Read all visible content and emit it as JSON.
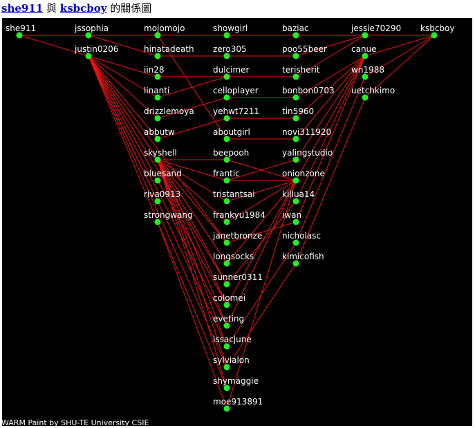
{
  "header": {
    "user_a": "she911",
    "connector": "與",
    "user_b": "ksbcboy",
    "suffix": "的關係圖"
  },
  "footer": {
    "credit": "WARM Paint by SHU-TE University CSIE"
  },
  "colors": {
    "background": "#000000",
    "node": "#22ee22",
    "edge": "#ee1111",
    "label": "#ffffff"
  },
  "graph": {
    "nodes": [
      {
        "id": "she911",
        "label": "she911",
        "col": 0,
        "row": 0
      },
      {
        "id": "jssophia",
        "label": "jssophia",
        "col": 1,
        "row": 0
      },
      {
        "id": "justin0206",
        "label": "justin0206",
        "col": 1,
        "row": 1
      },
      {
        "id": "mojomojo",
        "label": "mojomojo",
        "col": 2,
        "row": 0
      },
      {
        "id": "hinatadeath",
        "label": "hinatadeath",
        "col": 2,
        "row": 1
      },
      {
        "id": "iin28",
        "label": "iin28",
        "col": 2,
        "row": 2
      },
      {
        "id": "linanti",
        "label": "linanti",
        "col": 2,
        "row": 3
      },
      {
        "id": "drizzlemoya",
        "label": "drizzlemoya",
        "col": 2,
        "row": 4
      },
      {
        "id": "abbutw",
        "label": "abbutw",
        "col": 2,
        "row": 5
      },
      {
        "id": "skyshell",
        "label": "skyshell",
        "col": 2,
        "row": 6
      },
      {
        "id": "bluesand",
        "label": "bluesand",
        "col": 2,
        "row": 7
      },
      {
        "id": "riva0913",
        "label": "riva0913",
        "col": 2,
        "row": 8
      },
      {
        "id": "strongwang",
        "label": "strongwang",
        "col": 2,
        "row": 9
      },
      {
        "id": "showgirl",
        "label": "showgirl",
        "col": 3,
        "row": 0
      },
      {
        "id": "zero305",
        "label": "zero305",
        "col": 3,
        "row": 1
      },
      {
        "id": "dulcimer",
        "label": "dulcimer",
        "col": 3,
        "row": 2
      },
      {
        "id": "celloplayer",
        "label": "celloplayer",
        "col": 3,
        "row": 3
      },
      {
        "id": "yehwt7211",
        "label": "yehwt7211",
        "col": 3,
        "row": 4
      },
      {
        "id": "aboutgirl",
        "label": "aboutgirl",
        "col": 3,
        "row": 5
      },
      {
        "id": "beepooh",
        "label": "beepooh",
        "col": 3,
        "row": 6
      },
      {
        "id": "frantic",
        "label": "frantic",
        "col": 3,
        "row": 7
      },
      {
        "id": "tristantsai",
        "label": "tristantsai",
        "col": 3,
        "row": 8
      },
      {
        "id": "frankyu1984",
        "label": "frankyu1984",
        "col": 3,
        "row": 9
      },
      {
        "id": "janetbronze",
        "label": "janetbronze",
        "col": 3,
        "row": 10
      },
      {
        "id": "longsocks",
        "label": "longsocks",
        "col": 3,
        "row": 11
      },
      {
        "id": "sunner0311",
        "label": "sunner0311",
        "col": 3,
        "row": 12
      },
      {
        "id": "colomei",
        "label": "colomei",
        "col": 3,
        "row": 13
      },
      {
        "id": "eveting",
        "label": "eveting",
        "col": 3,
        "row": 14
      },
      {
        "id": "issacjune",
        "label": "issacjune",
        "col": 3,
        "row": 15
      },
      {
        "id": "sylvialon",
        "label": "sylvialon",
        "col": 3,
        "row": 16
      },
      {
        "id": "shymaggie",
        "label": "shymaggie",
        "col": 3,
        "row": 17
      },
      {
        "id": "moe913891",
        "label": "moe913891",
        "col": 3,
        "row": 18
      },
      {
        "id": "baziac",
        "label": "baziac",
        "col": 4,
        "row": 0
      },
      {
        "id": "poo55beer",
        "label": "poo55beer",
        "col": 4,
        "row": 1
      },
      {
        "id": "terisherit",
        "label": "terisherit",
        "col": 4,
        "row": 2
      },
      {
        "id": "bonbon0703",
        "label": "bonbon0703",
        "col": 4,
        "row": 3
      },
      {
        "id": "tin5960",
        "label": "tin5960",
        "col": 4,
        "row": 4
      },
      {
        "id": "novi311920",
        "label": "novi311920",
        "col": 4,
        "row": 5
      },
      {
        "id": "yalingstudio",
        "label": "yalingstudio",
        "col": 4,
        "row": 6
      },
      {
        "id": "onionzone",
        "label": "onionzone",
        "col": 4,
        "row": 7
      },
      {
        "id": "killua14",
        "label": "killua14",
        "col": 4,
        "row": 8
      },
      {
        "id": "iwan",
        "label": "iwan",
        "col": 4,
        "row": 9
      },
      {
        "id": "nicholasc",
        "label": "nicholasc",
        "col": 4,
        "row": 10
      },
      {
        "id": "kimicofish",
        "label": "kimicofish",
        "col": 4,
        "row": 11
      },
      {
        "id": "jessie70290",
        "label": "jessie70290",
        "col": 5,
        "row": 0
      },
      {
        "id": "canue",
        "label": "canue",
        "col": 5,
        "row": 1
      },
      {
        "id": "wn1988",
        "label": "wn1988",
        "col": 5,
        "row": 2
      },
      {
        "id": "uetchkimo",
        "label": "uetchkimo",
        "col": 5,
        "row": 3
      },
      {
        "id": "ksbcboy",
        "label": "ksbcboy",
        "col": 6,
        "row": 0
      }
    ],
    "edges": [
      [
        "she911",
        "jssophia"
      ],
      [
        "she911",
        "justin0206"
      ],
      [
        "jssophia",
        "mojomojo"
      ],
      [
        "jssophia",
        "hinatadeath"
      ],
      [
        "justin0206",
        "iin28"
      ],
      [
        "justin0206",
        "linanti"
      ],
      [
        "justin0206",
        "drizzlemoya"
      ],
      [
        "justin0206",
        "abbutw"
      ],
      [
        "justin0206",
        "skyshell"
      ],
      [
        "justin0206",
        "bluesand"
      ],
      [
        "justin0206",
        "riva0913"
      ],
      [
        "justin0206",
        "janetbronze"
      ],
      [
        "justin0206",
        "longsocks"
      ],
      [
        "justin0206",
        "sunner0311"
      ],
      [
        "justin0206",
        "colomei"
      ],
      [
        "justin0206",
        "eveting"
      ],
      [
        "justin0206",
        "issacjune"
      ],
      [
        "justin0206",
        "sylvialon"
      ],
      [
        "justin0206",
        "shymaggie"
      ],
      [
        "mojomojo",
        "showgirl"
      ],
      [
        "mojomojo",
        "aboutgirl"
      ],
      [
        "hinatadeath",
        "zero305"
      ],
      [
        "iin28",
        "dulcimer"
      ],
      [
        "linanti",
        "dulcimer"
      ],
      [
        "drizzlemoya",
        "celloplayer"
      ],
      [
        "abbutw",
        "yehwt7211"
      ],
      [
        "skyshell",
        "beepooh"
      ],
      [
        "skyshell",
        "frantic"
      ],
      [
        "skyshell",
        "tristantsai"
      ],
      [
        "skyshell",
        "frankyu1984"
      ],
      [
        "skyshell",
        "janetbronze"
      ],
      [
        "skyshell",
        "longsocks"
      ],
      [
        "skyshell",
        "sunner0311"
      ],
      [
        "skyshell",
        "colomei"
      ],
      [
        "skyshell",
        "eveting"
      ],
      [
        "skyshell",
        "issacjune"
      ],
      [
        "skyshell",
        "sylvialon"
      ],
      [
        "skyshell",
        "shymaggie"
      ],
      [
        "strongwang",
        "moe913891"
      ],
      [
        "showgirl",
        "baziac"
      ],
      [
        "zero305",
        "poo55beer"
      ],
      [
        "dulcimer",
        "terisherit"
      ],
      [
        "celloplayer",
        "bonbon0703"
      ],
      [
        "yehwt7211",
        "tin5960"
      ],
      [
        "aboutgirl",
        "novi311920"
      ],
      [
        "beepooh",
        "onionzone"
      ],
      [
        "frantic",
        "onionzone"
      ],
      [
        "frantic",
        "yalingstudio"
      ],
      [
        "tristantsai",
        "onionzone"
      ],
      [
        "frankyu1984",
        "onionzone"
      ],
      [
        "janetbronze",
        "iwan"
      ],
      [
        "longsocks",
        "onionzone"
      ],
      [
        "sunner0311",
        "killua14"
      ],
      [
        "colomei",
        "onionzone"
      ],
      [
        "eveting",
        "onionzone"
      ],
      [
        "issacjune",
        "nicholasc"
      ],
      [
        "sylvialon",
        "kimicofish"
      ],
      [
        "moe913891",
        "onionzone"
      ],
      [
        "baziac",
        "jessie70290"
      ],
      [
        "poo55beer",
        "jessie70290"
      ],
      [
        "terisherit",
        "jessie70290"
      ],
      [
        "bonbon0703",
        "canue"
      ],
      [
        "tin5960",
        "canue"
      ],
      [
        "novi311920",
        "canue"
      ],
      [
        "yalingstudio",
        "canue"
      ],
      [
        "onionzone",
        "canue"
      ],
      [
        "killua14",
        "canue"
      ],
      [
        "iwan",
        "canue"
      ],
      [
        "nicholasc",
        "wn1988"
      ],
      [
        "kimicofish",
        "uetchkimo"
      ],
      [
        "jessie70290",
        "ksbcboy"
      ],
      [
        "canue",
        "ksbcboy"
      ],
      [
        "wn1988",
        "ksbcboy"
      ],
      [
        "uetchkimo",
        "ksbcboy"
      ]
    ]
  }
}
